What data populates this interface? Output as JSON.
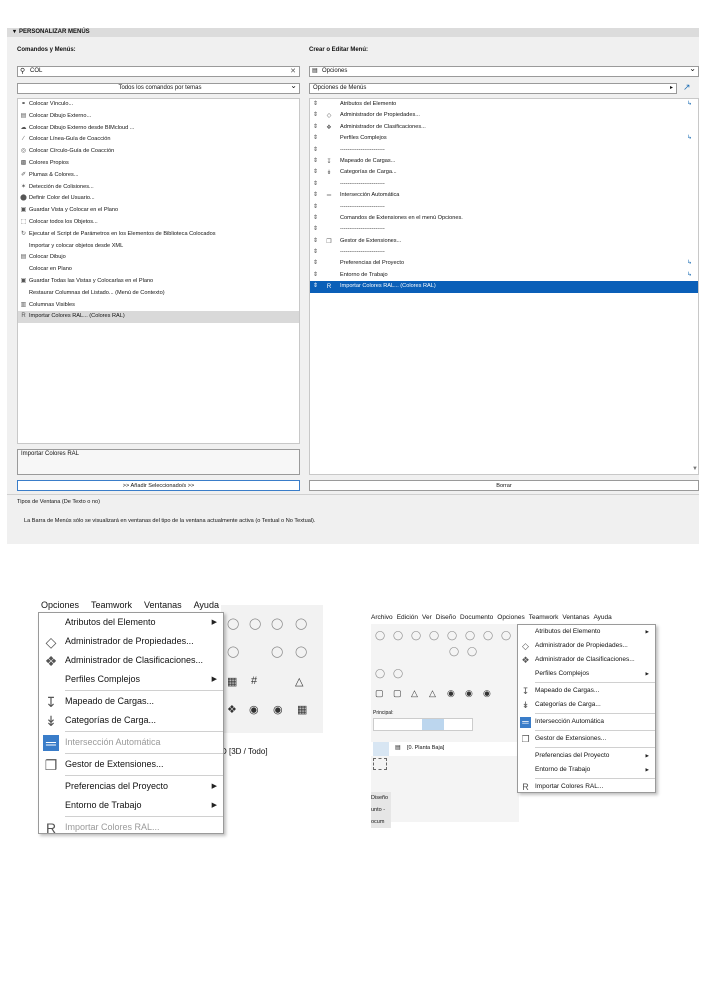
{
  "panel": {
    "header": "PERSONALIZAR MENÚS",
    "left_label": "Comandos y Menús:",
    "right_label": "Crear o Editar Menú:",
    "search_value": "COL",
    "filter_value": "Todos los comandos por temas",
    "menu_select": "Opciones",
    "submenu_select": "Opciones de Menús",
    "commands": [
      {
        "label": "Colocar Vínculo...",
        "icon": "link-icon"
      },
      {
        "label": "Colocar Dibujo Externo...",
        "icon": "drawing-icon"
      },
      {
        "label": "Colocar Dibujo Externo desde BIMcloud ...",
        "icon": "cloud-drawing-icon"
      },
      {
        "label": "Colocar Línea-Guía de Coacción",
        "icon": "guide-line-icon"
      },
      {
        "label": "Colocar Círculo-Guía de Coacción",
        "icon": "guide-circle-icon"
      },
      {
        "label": "Colores Propios",
        "icon": "colors-icon"
      },
      {
        "label": "Plumas & Colores...",
        "icon": "pen-icon"
      },
      {
        "label": "Detección de Colisiones...",
        "icon": "collision-icon"
      },
      {
        "label": "Definir Color del Usuario...",
        "icon": "user-color-icon"
      },
      {
        "label": "Guardar Vista y Colocar en el Plano",
        "icon": "save-view-icon"
      },
      {
        "label": "Colocar todos los Objetos...",
        "icon": "objects-icon"
      },
      {
        "label": "Ejecutar el Script de Parámetros en los Elementos de Biblioteca Colocados",
        "icon": "script-icon"
      },
      {
        "label": "Importar y colocar objetos desde XML",
        "icon": ""
      },
      {
        "label": "Colocar Dibujo",
        "icon": "place-drawing-icon"
      },
      {
        "label": "Colocar en Plano",
        "icon": ""
      },
      {
        "label": "Guardar Todas las Vistas y Colocarlas en el Plano",
        "icon": "save-all-icon"
      },
      {
        "label": "Restaurar Columnas del Listado... (Menú de Contexto)",
        "icon": ""
      },
      {
        "label": "Columnas Visibles",
        "icon": "columns-icon"
      },
      {
        "label": "Importar Colores RAL... (Colores RAL)",
        "icon": "ral-icon"
      }
    ],
    "menu_items": [
      {
        "label": "Atributos del Elemento",
        "icon": "",
        "sub": true
      },
      {
        "label": "Administrador de Propiedades...",
        "icon": "tag-icon",
        "sub": false
      },
      {
        "label": "Administrador de Clasificaciones...",
        "icon": "classification-icon",
        "sub": false
      },
      {
        "label": "Perfiles Complejos",
        "icon": "",
        "sub": true
      },
      {
        "label": "------------------------",
        "icon": "",
        "sub": false
      },
      {
        "label": "Mapeado de Cargas...",
        "icon": "load-map-icon",
        "sub": false
      },
      {
        "label": "Categorías de Carga...",
        "icon": "load-category-icon",
        "sub": false
      },
      {
        "label": "------------------------",
        "icon": "",
        "sub": false
      },
      {
        "label": "Intersección Automática",
        "icon": "intersection-icon",
        "sub": false
      },
      {
        "label": "------------------------",
        "icon": "",
        "sub": false
      },
      {
        "label": "Comandos de Extensiones en el menú Opciones.",
        "icon": "",
        "sub": false
      },
      {
        "label": "------------------------",
        "icon": "",
        "sub": false
      },
      {
        "label": "Gestor de Extensiones...",
        "icon": "extension-icon",
        "sub": false
      },
      {
        "label": "------------------------",
        "icon": "",
        "sub": false
      },
      {
        "label": "Preferencias del Proyecto",
        "icon": "",
        "sub": true
      },
      {
        "label": "Entorno de Trabajo",
        "icon": "",
        "sub": true
      },
      {
        "label": "Importar Colores RAL... (Colores RAL)",
        "icon": "ral-icon",
        "sub": false
      }
    ],
    "description": "Importar Colores RAL",
    "add_button": ">> Añadir Seleccionado/s >>",
    "delete_button": "Borrar",
    "window_types_label": "Tipos de Ventana (De Texto o no)",
    "window_types_note": "La Barra de Menús sólo se visualizará en ventanas del tipo de la ventana actualmente activa (o Textual o No Textual)."
  },
  "left_screenshot": {
    "menubar": [
      "Opciones",
      "Teamwork",
      "Ventanas",
      "Ayuda"
    ],
    "items": [
      {
        "label": "Atributos del Elemento",
        "icon": "",
        "sub": true,
        "disabled": false
      },
      {
        "label": "Administrador de Propiedades...",
        "icon": "tag-icon",
        "sub": false,
        "disabled": false
      },
      {
        "label": "Administrador de Clasificaciones...",
        "icon": "classification-icon",
        "sub": false,
        "disabled": false
      },
      {
        "label": "Perfiles Complejos",
        "icon": "",
        "sub": true,
        "disabled": false
      },
      {
        "sep": true
      },
      {
        "label": "Mapeado de Cargas...",
        "icon": "load-map-icon",
        "sub": false,
        "disabled": false
      },
      {
        "label": "Categorías de Carga...",
        "icon": "load-category-icon",
        "sub": false,
        "disabled": false
      },
      {
        "sep": true
      },
      {
        "label": "Intersección Automática",
        "icon": "intersection-icon",
        "sub": false,
        "disabled": true
      },
      {
        "sep": true
      },
      {
        "label": "Gestor de Extensiones...",
        "icon": "extension-icon",
        "sub": false,
        "disabled": false
      },
      {
        "sep": true
      },
      {
        "label": "Preferencias del Proyecto",
        "icon": "",
        "sub": true,
        "disabled": false
      },
      {
        "label": "Entorno de Trabajo",
        "icon": "",
        "sub": true,
        "disabled": false
      },
      {
        "sep": true
      },
      {
        "label": "Importar Colores RAL...",
        "icon": "ral-icon",
        "sub": false,
        "disabled": true
      }
    ],
    "status_text": "D [3D / Todo]"
  },
  "right_screenshot": {
    "menubar": [
      "Archivo",
      "Edición",
      "Ver",
      "Diseño",
      "Documento",
      "Opciones",
      "Teamwork",
      "Ventanas",
      "Ayuda"
    ],
    "items": [
      {
        "label": "Atributos del Elemento",
        "icon": "",
        "sub": true
      },
      {
        "label": "Administrador de Propiedades...",
        "icon": "tag-icon",
        "sub": false
      },
      {
        "label": "Administrador de Clasificaciones...",
        "icon": "classification-icon",
        "sub": false
      },
      {
        "label": "Perfiles Complejos",
        "icon": "",
        "sub": true
      },
      {
        "sep": true
      },
      {
        "label": "Mapeado de Cargas...",
        "icon": "load-map-icon",
        "sub": false
      },
      {
        "label": "Categorías de Carga...",
        "icon": "load-category-icon",
        "sub": false
      },
      {
        "sep": true
      },
      {
        "label": "Intersección Automática",
        "icon": "intersection-icon",
        "sub": false
      },
      {
        "sep": true
      },
      {
        "label": "Gestor de Extensiones...",
        "icon": "extension-icon",
        "sub": false
      },
      {
        "sep": true
      },
      {
        "label": "Preferencias del Proyecto",
        "icon": "",
        "sub": true
      },
      {
        "label": "Entorno de Trabajo",
        "icon": "",
        "sub": true
      },
      {
        "sep": true
      },
      {
        "label": "Importar Colores RAL...",
        "icon": "ral-icon",
        "sub": false
      }
    ],
    "toolbar_label": "Principal:",
    "tab_label": "[0. Planta Baja]",
    "side_labels": [
      "Diseño",
      "unto -",
      "ocum"
    ]
  }
}
